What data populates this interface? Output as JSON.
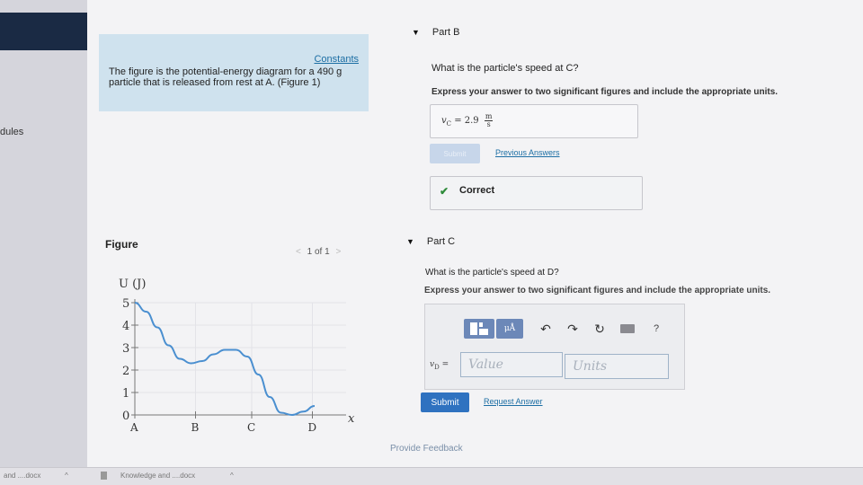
{
  "sidebar": {
    "modules_label": "dules"
  },
  "problem": {
    "constants_link": "Constants",
    "text": "The figure is the potential-energy diagram for a 490 g particle that is released from rest at A. (Figure 1)"
  },
  "figure": {
    "title": "Figure",
    "pager": "1 of 1",
    "prev_icon": "chevron-left-icon",
    "next_icon": "chevron-right-icon"
  },
  "part_b": {
    "header": "Part B",
    "question": "What is the particle's speed at C?",
    "instruction": "Express your answer to two significant figures and include the appropriate units.",
    "answer_var": "v",
    "answer_sub": "C",
    "answer_eq": " =  2.9",
    "unit_num": "m",
    "unit_den": "s",
    "submit_label": "Submit",
    "previous_answers": "Previous Answers",
    "correct_label": "Correct"
  },
  "part_c": {
    "header": "Part C",
    "question": "What is the particle's speed at D?",
    "instruction": "Express your answer to two significant figures and include the appropriate units.",
    "toolbar_units": "μÅ",
    "toolbar_help": "?",
    "answer_var": "v",
    "answer_sub": "D",
    "answer_eq": " =",
    "value_placeholder": "Value",
    "units_placeholder": "Units",
    "submit_label": "Submit",
    "request_answer": "Request Answer"
  },
  "provide_feedback": "Provide Feedback",
  "downloads": {
    "item1": "and ....docx",
    "item1_caret": "^",
    "item2": "Knowledge and ....docx",
    "item2_caret": "^"
  },
  "chart_data": {
    "type": "line",
    "ylabel": "U (J)",
    "xlabel": "x",
    "yticks": [
      "0",
      "1",
      "2",
      "3",
      "4",
      "5"
    ],
    "xticks": [
      "A",
      "B",
      "C",
      "D"
    ],
    "ylim": [
      0,
      5
    ],
    "grid": true,
    "series": [
      {
        "x": [
          0,
          0.5,
          1,
          1.5,
          2,
          2.5,
          3,
          3.5,
          4,
          4.5,
          5,
          5.5,
          6,
          6.5,
          7,
          7.5,
          8
        ],
        "y": [
          5,
          4.6,
          3.9,
          3.1,
          2.5,
          2.3,
          2.4,
          2.7,
          2.9,
          2.9,
          2.6,
          1.8,
          0.8,
          0.1,
          0,
          0.15,
          0.4
        ]
      }
    ],
    "x_positions": {
      "A": 0,
      "B": 2.7,
      "C": 5.2,
      "D": 7.9
    },
    "colors": {
      "curve": "#4a8fd0",
      "grid": "#e3e3e8",
      "axis": "#777777"
    }
  }
}
